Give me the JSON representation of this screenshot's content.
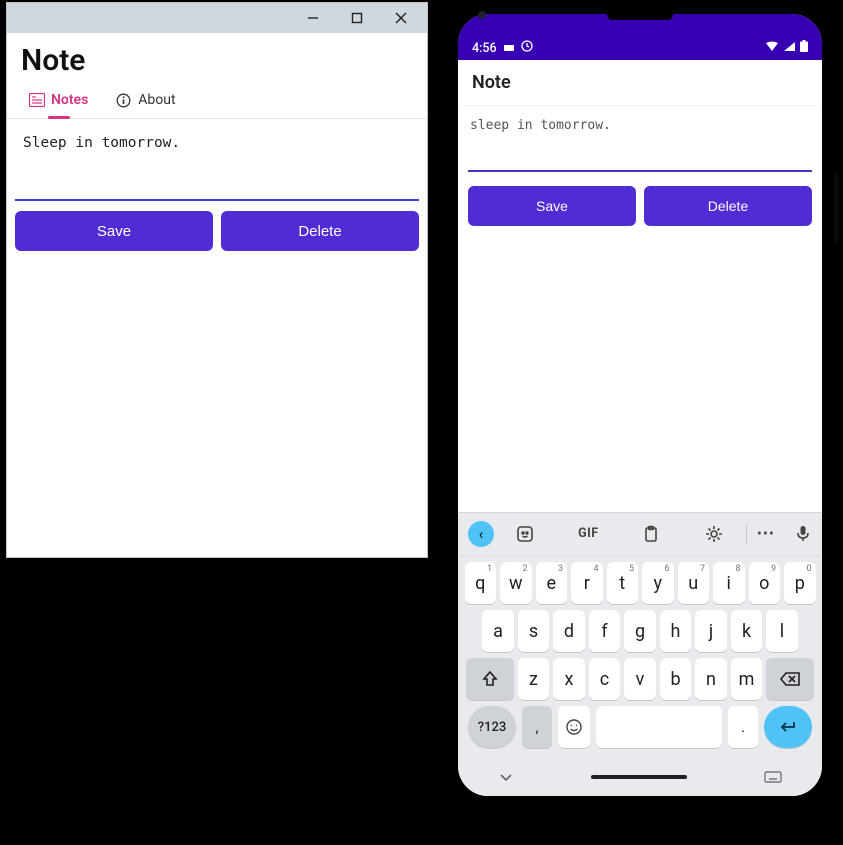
{
  "desktop": {
    "app_title": "Note",
    "tabs": {
      "notes": {
        "label": "Notes",
        "icon": "notes-icon"
      },
      "about": {
        "label": "About",
        "icon": "info-icon"
      }
    },
    "note_text": "Sleep in tomorrow.",
    "buttons": {
      "save": "Save",
      "delete": "Delete"
    }
  },
  "mobile": {
    "status": {
      "time": "4:56"
    },
    "app_title": "Note",
    "note_text": "sleep in tomorrow.",
    "buttons": {
      "save": "Save",
      "delete": "Delete"
    },
    "keyboard": {
      "toolbar": {
        "gif": "GIF"
      },
      "row1": [
        {
          "k": "q",
          "s": "1"
        },
        {
          "k": "w",
          "s": "2"
        },
        {
          "k": "e",
          "s": "3"
        },
        {
          "k": "r",
          "s": "4"
        },
        {
          "k": "t",
          "s": "5"
        },
        {
          "k": "y",
          "s": "6"
        },
        {
          "k": "u",
          "s": "7"
        },
        {
          "k": "i",
          "s": "8"
        },
        {
          "k": "o",
          "s": "9"
        },
        {
          "k": "p",
          "s": "0"
        }
      ],
      "row2": [
        "a",
        "s",
        "d",
        "f",
        "g",
        "h",
        "j",
        "k",
        "l"
      ],
      "row3": [
        "z",
        "x",
        "c",
        "v",
        "b",
        "n",
        "m"
      ],
      "symbols_key": "?123",
      "comma_key": ",",
      "period_key": "."
    }
  }
}
